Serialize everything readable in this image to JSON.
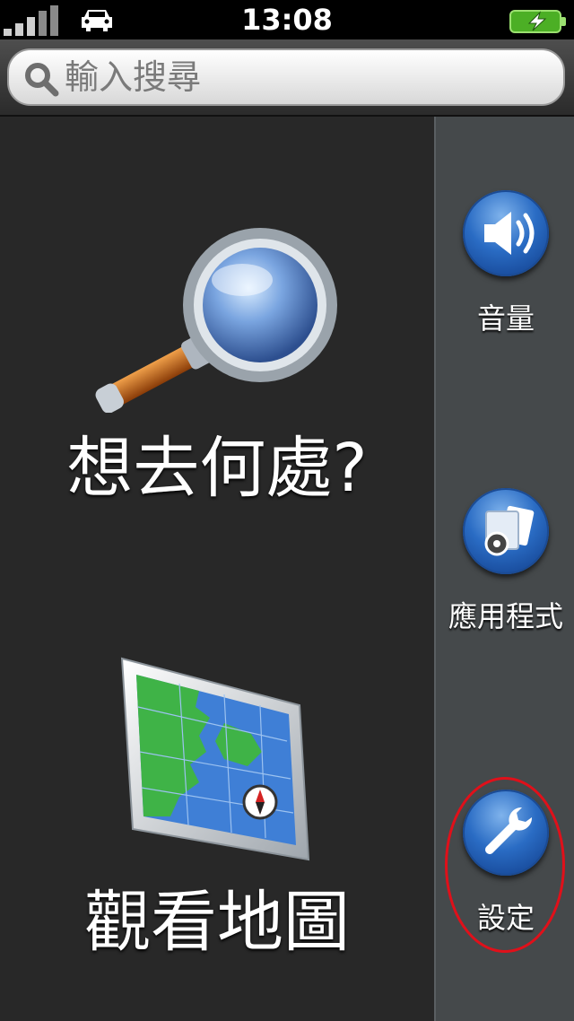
{
  "status_bar": {
    "time": "13:08"
  },
  "search": {
    "placeholder": "輸入搜尋"
  },
  "main": {
    "where_to": {
      "label": "想去何處?"
    },
    "view_map": {
      "label": "觀看地圖"
    }
  },
  "sidebar": {
    "volume": {
      "label": "音量"
    },
    "apps": {
      "label": "應用程式"
    },
    "settings": {
      "label": "設定"
    }
  }
}
